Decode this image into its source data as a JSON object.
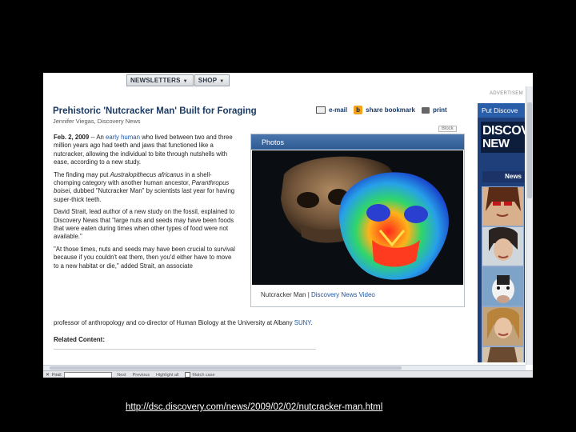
{
  "nav": {
    "newsletters": "NEWSLETTERS",
    "shop": "SHOP",
    "caret": "▼"
  },
  "ad_label": "ADVERTISEM",
  "article": {
    "title": "Prehistoric 'Nutcracker Man' Built for Foraging",
    "byline": "Jennifer Viegas, Discovery News",
    "tools": {
      "email": "e-mail",
      "share": "share bookmark",
      "print": "print"
    },
    "p1_date": "Feb. 2, 2009",
    "p1_sep": " -- An ",
    "p1_link": "early human",
    "p1_rest": " who lived between two and three million years ago had teeth and jaws that functioned like a nutcracker, allowing the individual to bite through nutshells with ease, according to a new study.",
    "p2_a": "The finding may put ",
    "p2_b": "Australopithecus africanus",
    "p2_c": " in a shell-chomping category with another human ancestor, ",
    "p2_d": "Paranthropus boisei",
    "p2_e": ", dubbed \"Nutcracker Man\" by scientists last year for having super-thick teeth.",
    "p3": "David Strait, lead author of a new study on the fossil, explained to Discovery News that \"large nuts and seeds may have been foods that were eaten during times when other types of food were not available.\"",
    "p4": "\"At those times, nuts and seeds may have been crucial to survival because if you couldn't eat them, then you'd either have to move to a new habitat or die,\" added Strait, an associate",
    "p4_full": "professor of anthropology and co-director of Human Biology at the University at Albany ",
    "p4_link": "SUNY",
    "p4_end": ".",
    "related": "Related Content:"
  },
  "photos": {
    "block": "Block",
    "header": "Photos",
    "caption": "Nutcracker Man",
    "sep": " | ",
    "video_link": "Discovery News Video"
  },
  "ad": {
    "header": "Put Discove",
    "logo_1": "DISCOVE",
    "logo_2": "NEW",
    "news": "News"
  },
  "findbar": {
    "close": "✕",
    "find": "Find:",
    "next": "Next",
    "previous": "Previous",
    "highlight": "Highlight all",
    "match_case": "Match case"
  },
  "url": "http://dsc.discovery.com/news/2009/02/02/nutcracker-man.html"
}
